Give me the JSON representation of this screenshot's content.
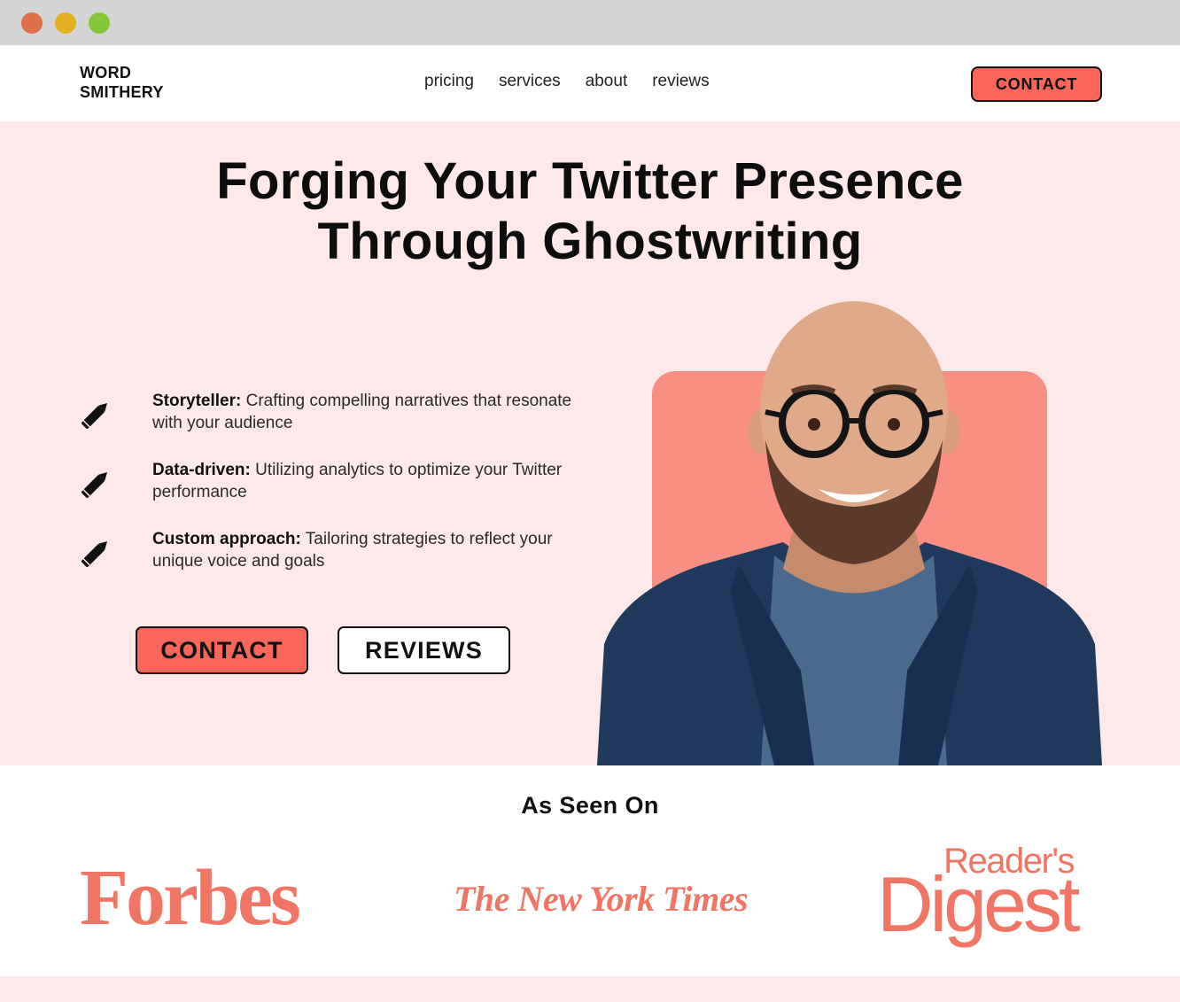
{
  "header": {
    "logo_line1": "WORD",
    "logo_line2": "SMITHERY",
    "nav": [
      "pricing",
      "services",
      "about",
      "reviews"
    ],
    "contact_label": "CONTACT"
  },
  "hero": {
    "title_line1": "Forging Your Twitter Presence",
    "title_line2": "Through Ghostwriting",
    "features": [
      {
        "bold": "Storyteller:",
        "text": "Crafting compelling narratives that resonate with your audience",
        "icon": "pencil-icon"
      },
      {
        "bold": "Data-driven:",
        "text": "Utilizing analytics to optimize your Twitter performance",
        "icon": "pencil-icon"
      },
      {
        "bold": "Custom approach:",
        "text": "Tailoring strategies to reflect your unique voice and goals",
        "icon": "pencil-icon"
      }
    ],
    "contact_button": "CONTACT",
    "reviews_button": "REVIEWS"
  },
  "seen_on": {
    "title": "As Seen On",
    "brands": {
      "forbes": "Forbes",
      "nyt": "The New York Times",
      "rd_top": "Reader's",
      "rd_bottom": "Digest"
    }
  },
  "colors": {
    "accent": "#f8675a",
    "hero_bg": "#fde9e9",
    "portrait_bg": "#f98e83",
    "logo_color": "#f07565"
  }
}
